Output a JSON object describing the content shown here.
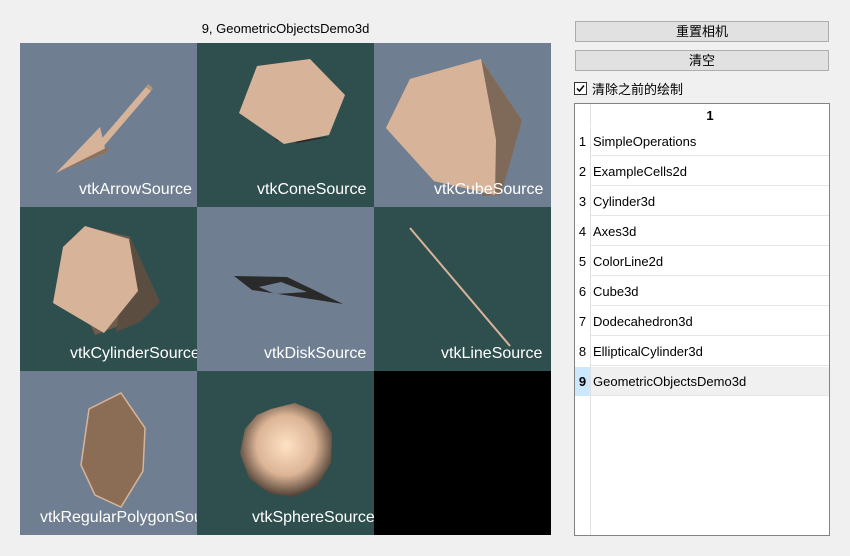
{
  "window": {
    "title": "9, GeometricObjectsDemo3d"
  },
  "controls": {
    "reset_camera_label": "重置相机",
    "clear_label": "清空",
    "clear_previous_label": "清除之前的绘制",
    "clear_previous_checked": true
  },
  "render": {
    "cells": [
      {
        "label": "vtkArrowSource",
        "bg": "#6f7f91"
      },
      {
        "label": "vtkConeSource",
        "bg": "#2f4f4f"
      },
      {
        "label": "vtkCubeSource",
        "bg": "#6f7f91"
      },
      {
        "label": "vtkCylinderSource",
        "bg": "#2f4f4f"
      },
      {
        "label": "vtkDiskSource",
        "bg": "#6f7f91"
      },
      {
        "label": "vtkLineSource",
        "bg": "#2f4f4f"
      },
      {
        "label": "vtkRegularPolygonSource",
        "bg": "#6f7f91"
      },
      {
        "label": "vtkSphereSource",
        "bg": "#2f4f4f"
      }
    ],
    "object_color": "#d7b399"
  },
  "table": {
    "column_header": "1",
    "selected_index": 8,
    "rows": [
      {
        "num": "1",
        "value": "SimpleOperations"
      },
      {
        "num": "2",
        "value": "ExampleCells2d"
      },
      {
        "num": "3",
        "value": "Cylinder3d"
      },
      {
        "num": "4",
        "value": "Axes3d"
      },
      {
        "num": "5",
        "value": "ColorLine2d"
      },
      {
        "num": "6",
        "value": "Cube3d"
      },
      {
        "num": "7",
        "value": "Dodecahedron3d"
      },
      {
        "num": "8",
        "value": "EllipticalCylinder3d"
      },
      {
        "num": "9",
        "value": "GeometricObjectsDemo3d"
      }
    ]
  }
}
